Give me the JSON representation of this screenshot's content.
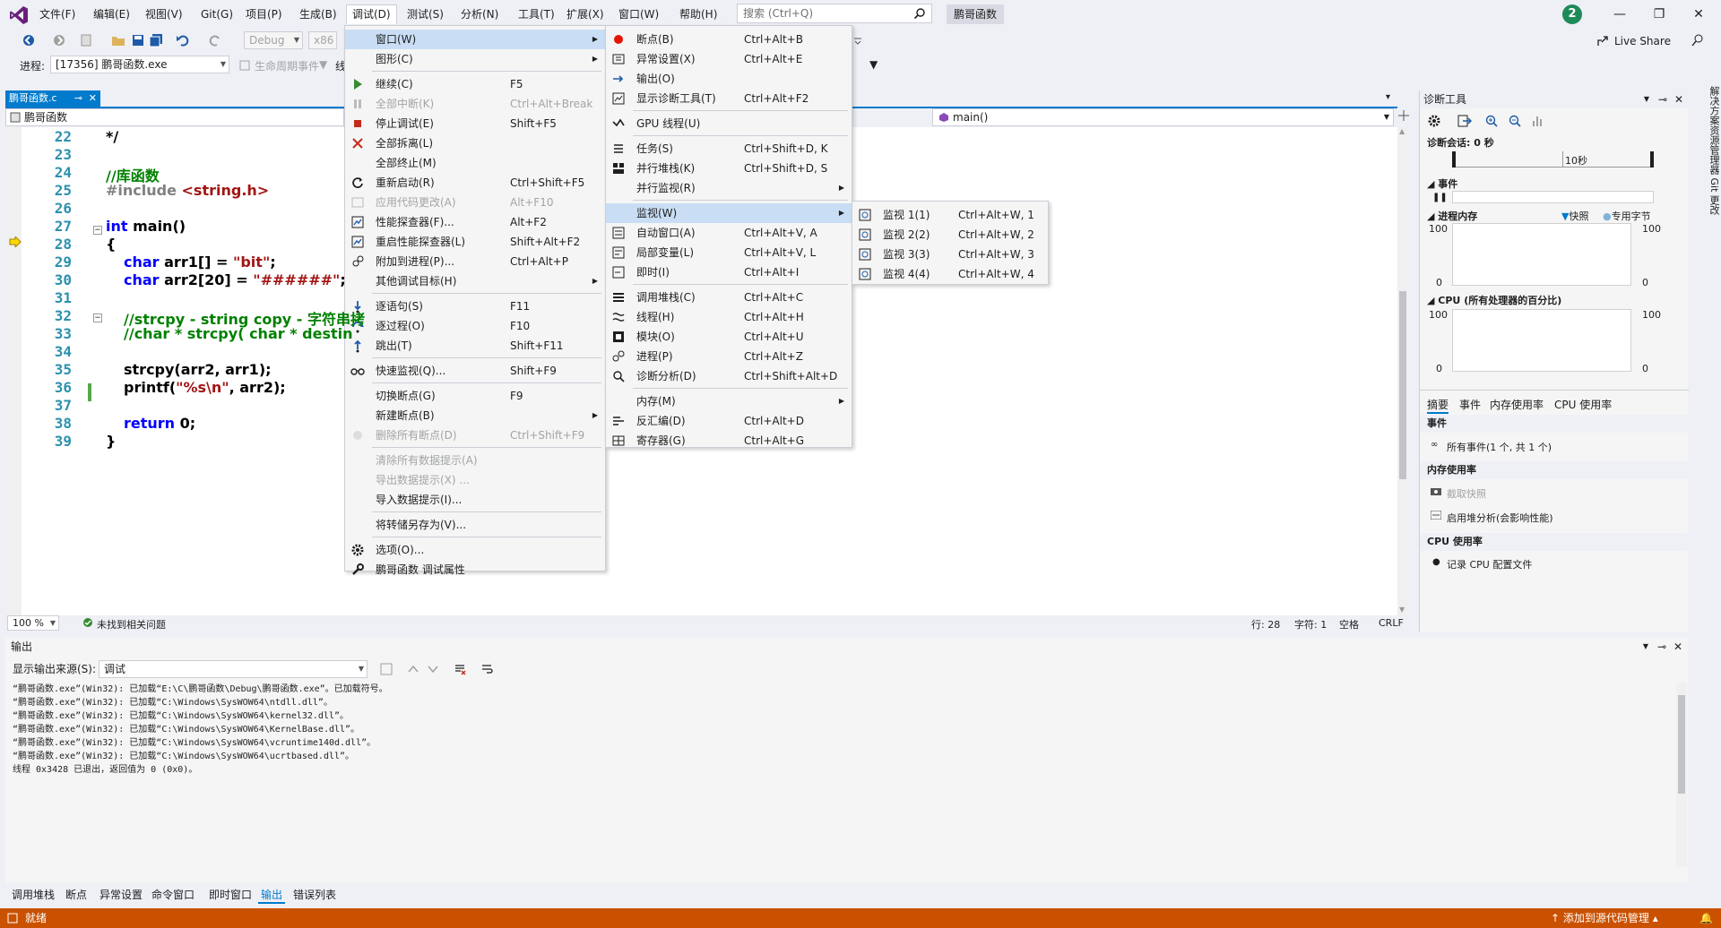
{
  "app": {
    "solution_title": "鹏哥函数",
    "badge": "2",
    "live_share": "Live Share"
  },
  "menubar": [
    "文件(F)",
    "编辑(E)",
    "视图(V)",
    "Git(G)",
    "项目(P)",
    "生成(B)",
    "调试(D)",
    "测试(S)",
    "分析(N)",
    "工具(T)",
    "扩展(X)",
    "窗口(W)",
    "帮助(H)"
  ],
  "search": {
    "placeholder": "搜索 (Ctrl+Q)"
  },
  "toolbar": {
    "config": "Debug",
    "platform": "x86",
    "process_label": "进程:",
    "process_value": "[17356] 鹏哥函数.exe",
    "lifecycle": "生命周期事件",
    "thread_label": "线"
  },
  "editor": {
    "tab_title": "鹏哥函数.c",
    "nav_project": "鹏哥函数",
    "nav_function": "main()",
    "zoom": "100 %",
    "issues": "未找到相关问题",
    "line": "行: 28",
    "col": "字符: 1",
    "tabs": "空格",
    "eol": "CRLF",
    "lines": [
      {
        "n": "22",
        "text": "*/"
      },
      {
        "n": "23",
        "text": ""
      },
      {
        "n": "24",
        "text": "//库函数"
      },
      {
        "n": "25",
        "text": "#include <string.h>"
      },
      {
        "n": "26",
        "text": ""
      },
      {
        "n": "27",
        "text": "int main()"
      },
      {
        "n": "28",
        "text": "{"
      },
      {
        "n": "29",
        "text": "char arr1[] = \"bit\";"
      },
      {
        "n": "30",
        "text": "char arr2[20] = \"######\";"
      },
      {
        "n": "31",
        "text": ""
      },
      {
        "n": "32",
        "text": "//strcpy - string copy - 字符串拷"
      },
      {
        "n": "33",
        "text": "//char * strcpy( char * destin"
      },
      {
        "n": "34",
        "text": ""
      },
      {
        "n": "35",
        "text": "strcpy(arr2, arr1);"
      },
      {
        "n": "36",
        "text": "printf(\"%s\\n\", arr2);"
      },
      {
        "n": "37",
        "text": ""
      },
      {
        "n": "38",
        "text": "return 0;"
      },
      {
        "n": "39",
        "text": "}"
      }
    ]
  },
  "debug_menu": {
    "title": "调试(D)",
    "items": [
      {
        "label": "窗口(W)",
        "shortcut": "",
        "sub": true,
        "highlight": true
      },
      {
        "label": "图形(C)",
        "shortcut": "",
        "sub": true
      },
      {
        "label": "继续(C)",
        "shortcut": "F5",
        "icon": "play-icon"
      },
      {
        "label": "全部中断(K)",
        "shortcut": "Ctrl+Alt+Break",
        "disabled": true,
        "icon": "pause-icon"
      },
      {
        "label": "停止调试(E)",
        "shortcut": "Shift+F5",
        "icon": "stop-icon"
      },
      {
        "label": "全部拆离(L)",
        "shortcut": "",
        "icon": "detach-icon"
      },
      {
        "label": "全部终止(M)",
        "shortcut": ""
      },
      {
        "label": "重新启动(R)",
        "shortcut": "Ctrl+Shift+F5",
        "icon": "restart-icon"
      },
      {
        "label": "应用代码更改(A)",
        "shortcut": "Alt+F10",
        "disabled": true,
        "icon": "hot-reload-icon"
      },
      {
        "label": "性能探查器(F)...",
        "shortcut": "Alt+F2",
        "icon": "profiler-icon"
      },
      {
        "label": "重启性能探查器(L)",
        "shortcut": "Shift+Alt+F2",
        "icon": "profiler-restart-icon"
      },
      {
        "label": "附加到进程(P)...",
        "shortcut": "Ctrl+Alt+P",
        "icon": "attach-icon"
      },
      {
        "label": "其他调试目标(H)",
        "shortcut": "",
        "sub": true
      },
      {
        "label": "逐语句(S)",
        "shortcut": "F11",
        "icon": "step-into-icon"
      },
      {
        "label": "逐过程(O)",
        "shortcut": "F10",
        "icon": "step-over-icon"
      },
      {
        "label": "跳出(T)",
        "shortcut": "Shift+F11",
        "icon": "step-out-icon"
      },
      {
        "label": "快速监视(Q)...",
        "shortcut": "Shift+F9",
        "icon": "quickwatch-icon"
      },
      {
        "label": "切换断点(G)",
        "shortcut": "F9"
      },
      {
        "label": "新建断点(B)",
        "shortcut": "",
        "sub": true
      },
      {
        "label": "删除所有断点(D)",
        "shortcut": "Ctrl+Shift+F9",
        "disabled": true,
        "icon": "delete-breakpoints-icon"
      },
      {
        "label": "清除所有数据提示(A)",
        "shortcut": "",
        "disabled": true
      },
      {
        "label": "导出数据提示(X) ...",
        "shortcut": "",
        "disabled": true
      },
      {
        "label": "导入数据提示(I)...",
        "shortcut": ""
      },
      {
        "label": "将转储另存为(V)...",
        "shortcut": ""
      },
      {
        "label": "选项(O)...",
        "shortcut": "",
        "icon": "gear-icon"
      },
      {
        "label": "鹏哥函数 调试属性",
        "shortcut": "",
        "icon": "wrench-icon"
      }
    ]
  },
  "window_menu": {
    "items": [
      {
        "label": "断点(B)",
        "shortcut": "Ctrl+Alt+B",
        "icon": "breakpoint-icon"
      },
      {
        "label": "异常设置(X)",
        "shortcut": "Ctrl+Alt+E",
        "icon": "exception-icon"
      },
      {
        "label": "输出(O)",
        "shortcut": "",
        "icon": "output-icon"
      },
      {
        "label": "显示诊断工具(T)",
        "shortcut": "Ctrl+Alt+F2",
        "icon": "diagnostics-icon"
      },
      {
        "label": "GPU 线程(U)",
        "shortcut": "",
        "icon": "gpu-icon"
      },
      {
        "label": "任务(S)",
        "shortcut": "Ctrl+Shift+D, K",
        "icon": "tasks-icon"
      },
      {
        "label": "并行堆栈(K)",
        "shortcut": "Ctrl+Shift+D, S",
        "icon": "parallel-stacks-icon"
      },
      {
        "label": "并行监视(R)",
        "shortcut": "",
        "sub": true
      },
      {
        "label": "监视(W)",
        "shortcut": "",
        "sub": true,
        "highlight": true
      },
      {
        "label": "自动窗口(A)",
        "shortcut": "Ctrl+Alt+V, A",
        "icon": "autos-icon"
      },
      {
        "label": "局部变量(L)",
        "shortcut": "Ctrl+Alt+V, L",
        "icon": "locals-icon"
      },
      {
        "label": "即时(I)",
        "shortcut": "Ctrl+Alt+I",
        "icon": "immediate-icon"
      },
      {
        "label": "调用堆栈(C)",
        "shortcut": "Ctrl+Alt+C",
        "icon": "callstack-icon"
      },
      {
        "label": "线程(H)",
        "shortcut": "Ctrl+Alt+H",
        "icon": "threads-icon"
      },
      {
        "label": "模块(O)",
        "shortcut": "Ctrl+Alt+U",
        "icon": "modules-icon"
      },
      {
        "label": "进程(P)",
        "shortcut": "Ctrl+Alt+Z",
        "icon": "processes-icon"
      },
      {
        "label": "诊断分析(D)",
        "shortcut": "Ctrl+Shift+Alt+D",
        "icon": "analysis-icon"
      },
      {
        "label": "内存(M)",
        "shortcut": "",
        "sub": true
      },
      {
        "label": "反汇编(D)",
        "shortcut": "Ctrl+Alt+D",
        "icon": "disassembly-icon"
      },
      {
        "label": "寄存器(G)",
        "shortcut": "Ctrl+Alt+G",
        "icon": "registers-icon"
      }
    ]
  },
  "watch_menu": {
    "items": [
      {
        "label": "监视 1(1)",
        "shortcut": "Ctrl+Alt+W, 1"
      },
      {
        "label": "监视 2(2)",
        "shortcut": "Ctrl+Alt+W, 2"
      },
      {
        "label": "监视 3(3)",
        "shortcut": "Ctrl+Alt+W, 3"
      },
      {
        "label": "监视 4(4)",
        "shortcut": "Ctrl+Alt+W, 4"
      }
    ]
  },
  "diagnostics": {
    "title": "诊断工具",
    "session": "诊断会话: 0 秒",
    "timeline_label": "10秒",
    "events": "事件",
    "memory": "进程内存",
    "legend_snapshot": "快照",
    "legend_private": "专用字节",
    "cpu": "CPU (所有处理器的百分比)",
    "axis_max": "100",
    "axis_min": "0",
    "tabs": [
      "摘要",
      "事件",
      "内存使用率",
      "CPU 使用率"
    ],
    "group_events": "事件",
    "all_events": "所有事件(1 个, 共 1 个)",
    "group_memory": "内存使用率",
    "take_snapshot": "截取快照",
    "heap_profiling": "启用堆分析(会影响性能)",
    "group_cpu": "CPU 使用率",
    "record_cpu": "记录 CPU 配置文件"
  },
  "rail": "解决方案资源管理器  Git 更改",
  "output": {
    "title": "输出",
    "source_label": "显示输出来源(S):",
    "source_value": "调试",
    "lines": [
      "“鹏哥函数.exe”(Win32): 已加载“E:\\C\\鹏哥函数\\Debug\\鹏哥函数.exe”。已加载符号。",
      "“鹏哥函数.exe”(Win32): 已加载“C:\\Windows\\SysWOW64\\ntdll.dll”。",
      "“鹏哥函数.exe”(Win32): 已加载“C:\\Windows\\SysWOW64\\kernel32.dll”。",
      "“鹏哥函数.exe”(Win32): 已加载“C:\\Windows\\SysWOW64\\KernelBase.dll”。",
      "“鹏哥函数.exe”(Win32): 已加载“C:\\Windows\\SysWOW64\\vcruntime140d.dll”。",
      "“鹏哥函数.exe”(Win32): 已加载“C:\\Windows\\SysWOW64\\ucrtbased.dll”。",
      "线程 0x3428 已退出，返回值为 0 (0x0)。"
    ]
  },
  "bottom_tabs": [
    "调用堆栈",
    "断点",
    "异常设置",
    "命令窗口",
    "即时窗口",
    "输出",
    "错误列表"
  ],
  "status": {
    "ready": "就绪",
    "source_control": "添加到源代码管理"
  }
}
